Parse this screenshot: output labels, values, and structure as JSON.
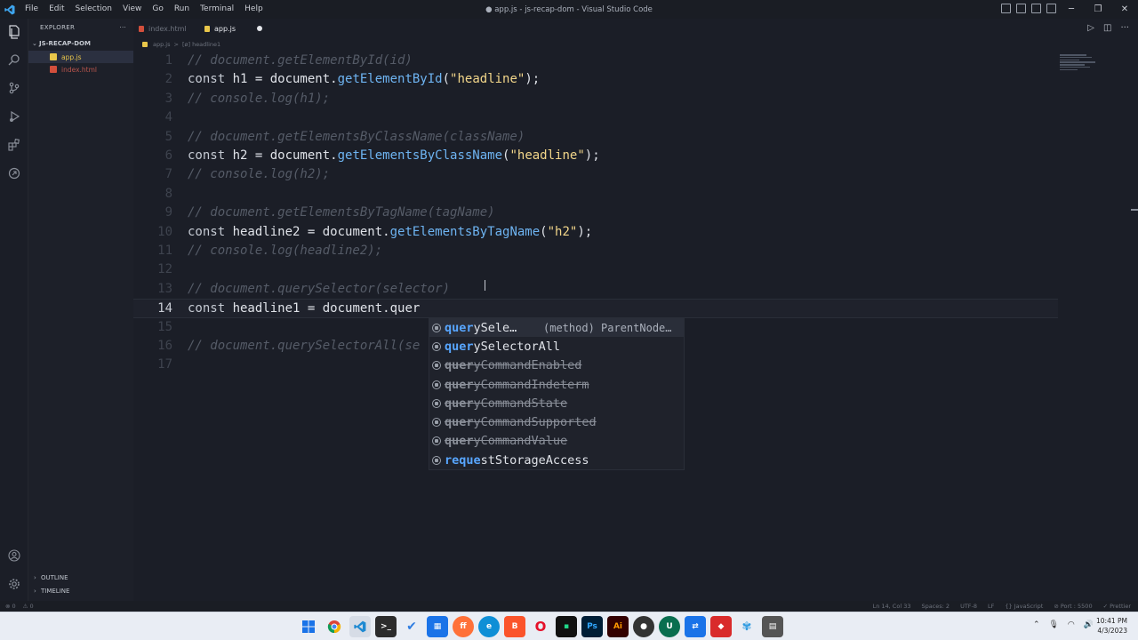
{
  "titlebar": {
    "menu": [
      "File",
      "Edit",
      "Selection",
      "View",
      "Go",
      "Run",
      "Terminal",
      "Help"
    ],
    "title": "● app.js - js-recap-dom - Visual Studio Code"
  },
  "sidebar": {
    "header": "EXPLORER",
    "header_more": "···",
    "folder": "JS-RECAP-DOM",
    "files": [
      {
        "name": "app.js",
        "type": "js",
        "active": true
      },
      {
        "name": "index.html",
        "type": "html",
        "active": false
      }
    ],
    "outline": "OUTLINE",
    "timeline": "TIMELINE"
  },
  "tabs": [
    {
      "label": "index.html",
      "type": "html",
      "active": false
    },
    {
      "label": "app.js",
      "type": "js",
      "active": true,
      "modified": true
    }
  ],
  "breadcrumb": {
    "file": "app.js",
    "separator": ">",
    "symbol": "[ø] headline1"
  },
  "editor": {
    "current_line": 14,
    "lines": [
      {
        "n": "1",
        "tokens": [
          {
            "t": "// document.getElementById(id)",
            "c": "cm"
          }
        ]
      },
      {
        "n": "2",
        "tokens": [
          {
            "t": "const ",
            "c": "kw"
          },
          {
            "t": "h1 = document.",
            "c": "pl"
          },
          {
            "t": "getElementById",
            "c": "fn"
          },
          {
            "t": "(",
            "c": "pl"
          },
          {
            "t": "\"headline\"",
            "c": "str"
          },
          {
            "t": ");",
            "c": "pl"
          }
        ]
      },
      {
        "n": "3",
        "tokens": [
          {
            "t": "// console.log(h1);",
            "c": "cm"
          }
        ]
      },
      {
        "n": "4",
        "tokens": []
      },
      {
        "n": "5",
        "tokens": [
          {
            "t": "// document.getElementsByClassName(className)",
            "c": "cm"
          }
        ]
      },
      {
        "n": "6",
        "tokens": [
          {
            "t": "const ",
            "c": "kw"
          },
          {
            "t": "h2 = document.",
            "c": "pl"
          },
          {
            "t": "getElementsByClassName",
            "c": "fn"
          },
          {
            "t": "(",
            "c": "pl"
          },
          {
            "t": "\"headline\"",
            "c": "str"
          },
          {
            "t": ");",
            "c": "pl"
          }
        ]
      },
      {
        "n": "7",
        "tokens": [
          {
            "t": "// console.log(h2);",
            "c": "cm"
          }
        ]
      },
      {
        "n": "8",
        "tokens": []
      },
      {
        "n": "9",
        "tokens": [
          {
            "t": "// document.getElementsByTagName(tagName)",
            "c": "cm"
          }
        ]
      },
      {
        "n": "10",
        "tokens": [
          {
            "t": "const ",
            "c": "kw"
          },
          {
            "t": "headline2 = document.",
            "c": "pl"
          },
          {
            "t": "getElementsByTagName",
            "c": "fn"
          },
          {
            "t": "(",
            "c": "pl"
          },
          {
            "t": "\"h2\"",
            "c": "str"
          },
          {
            "t": ");",
            "c": "pl"
          }
        ]
      },
      {
        "n": "11",
        "tokens": [
          {
            "t": "// console.log(headline2);",
            "c": "cm"
          }
        ]
      },
      {
        "n": "12",
        "tokens": []
      },
      {
        "n": "13",
        "tokens": [
          {
            "t": "// document.querySelector(selector)",
            "c": "cm"
          }
        ]
      },
      {
        "n": "14",
        "tokens": [
          {
            "t": "const ",
            "c": "kw"
          },
          {
            "t": "headline1 = document.quer",
            "c": "pl"
          }
        ]
      },
      {
        "n": "15",
        "tokens": []
      },
      {
        "n": "16",
        "tokens": [
          {
            "t": "// document.querySelectorAll(se",
            "c": "cm"
          }
        ]
      },
      {
        "n": "17",
        "tokens": []
      }
    ]
  },
  "suggest": {
    "items": [
      {
        "match": "quer",
        "rest": "ySele…",
        "detail": "(method) ParentNode…",
        "selected": true,
        "deprecated": false
      },
      {
        "match": "quer",
        "rest": "ySelectorAll",
        "detail": "",
        "selected": false,
        "deprecated": false
      },
      {
        "match": "quer",
        "rest": "yCommandEnabled",
        "detail": "",
        "selected": false,
        "deprecated": true
      },
      {
        "match": "quer",
        "rest": "yCommandIndeterm",
        "detail": "",
        "selected": false,
        "deprecated": true
      },
      {
        "match": "quer",
        "rest": "yCommandState",
        "detail": "",
        "selected": false,
        "deprecated": true
      },
      {
        "match": "quer",
        "rest": "yCommandSupported",
        "detail": "",
        "selected": false,
        "deprecated": true
      },
      {
        "match": "quer",
        "rest": "yCommandValue",
        "detail": "",
        "selected": false,
        "deprecated": true
      },
      {
        "match": "reque",
        "rest": "stStorageAccess",
        "detail": "",
        "selected": false,
        "deprecated": false,
        "split": true
      }
    ]
  },
  "statusbar": {
    "left": [
      "⊗ 0",
      "⚠ 0"
    ],
    "right": [
      "Ln 14, Col 33",
      "Spaces: 2",
      "UTF-8",
      "LF",
      "{} JavaScript",
      "⊘ Port : 5500",
      "✓ Prettier"
    ]
  },
  "taskbar": {
    "time": "10:41 PM",
    "date": "4/3/2023"
  },
  "colors": {
    "editor_bg": "#1b1e27",
    "function": "#6eb4f2",
    "string": "#f2d68a",
    "comment": "#555b67",
    "match_highlight": "#58a6ff"
  }
}
